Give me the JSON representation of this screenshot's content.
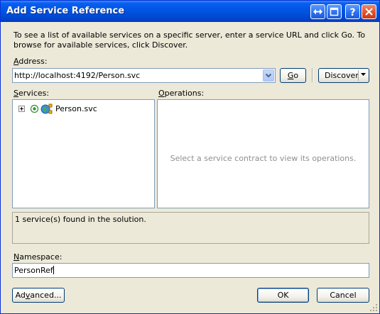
{
  "window": {
    "title": "Add Service Reference"
  },
  "description": "To see a list of available services on a specific server, enter a service URL and click Go. To browse for available services, click Discover.",
  "address": {
    "label_underlined": "A",
    "label_rest": "ddress:",
    "value": "http://localhost:4192/Person.svc"
  },
  "buttons": {
    "go_underlined": "G",
    "go_rest": "o",
    "discover": "Discover",
    "advanced_pre": "Ad",
    "advanced_underlined": "v",
    "advanced_post": "anced...",
    "ok": "OK",
    "cancel": "Cancel"
  },
  "services": {
    "label_underlined": "S",
    "label_rest": "ervices:",
    "tree": [
      {
        "label": "Person.svc",
        "expand_glyph": "+"
      }
    ]
  },
  "operations": {
    "label_underlined": "O",
    "label_rest": "perations:",
    "placeholder": "Select a service contract to view its operations."
  },
  "status": {
    "text": "1 service(s) found in the solution."
  },
  "namespace": {
    "label_underlined": "N",
    "label_rest": "amespace:",
    "value": "PersonRef"
  },
  "titlebar_icons": [
    "restore-arrows-icon",
    "maximize-icon",
    "help-icon",
    "close-icon"
  ],
  "colors": {
    "titlebar": "#0054e3",
    "dialog_bg": "#ece9d8",
    "border": "#7f9db9",
    "close": "#e0532e"
  }
}
